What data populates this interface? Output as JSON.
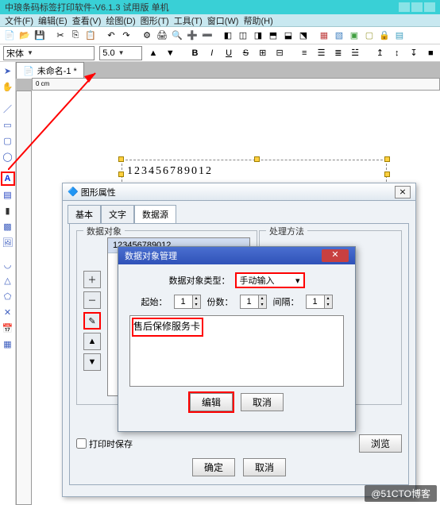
{
  "title_bar": "中琅条码标签打印软件-V6.1.3 试用版 单机",
  "menus": [
    "文件(F)",
    "编辑(E)",
    "查看(V)",
    "绘图(D)",
    "图形(T)",
    "工具(T)",
    "窗口(W)",
    "帮助(H)"
  ],
  "font_row": {
    "font": "宋体",
    "size": "5.0",
    "bold": "B",
    "italic": "I",
    "underline": "U",
    "strike": "S"
  },
  "doc_tab": "未命名-1 *",
  "ruler_label": "0 cm",
  "canvas_text": "123456789012",
  "dlg1": {
    "title": "图形属性",
    "tabs": [
      "基本",
      "文字",
      "数据源"
    ],
    "group_left": "数据对象",
    "group_right": "处理方法",
    "list_row": "123456789012",
    "save_chk": "打印时保存",
    "browse": "浏览",
    "ok": "确定",
    "cancel": "取消"
  },
  "dlg2": {
    "title": "数据对象管理",
    "type_label": "数据对象类型：",
    "type_value": "手动输入",
    "start_label": "起始：",
    "start_val": "1",
    "count_label": "份数：",
    "count_val": "1",
    "gap_label": "间隔：",
    "gap_val": "1",
    "text": "售后保修服务卡",
    "edit": "编辑",
    "cancel": "取消"
  },
  "watermark": "@51CTO博客"
}
